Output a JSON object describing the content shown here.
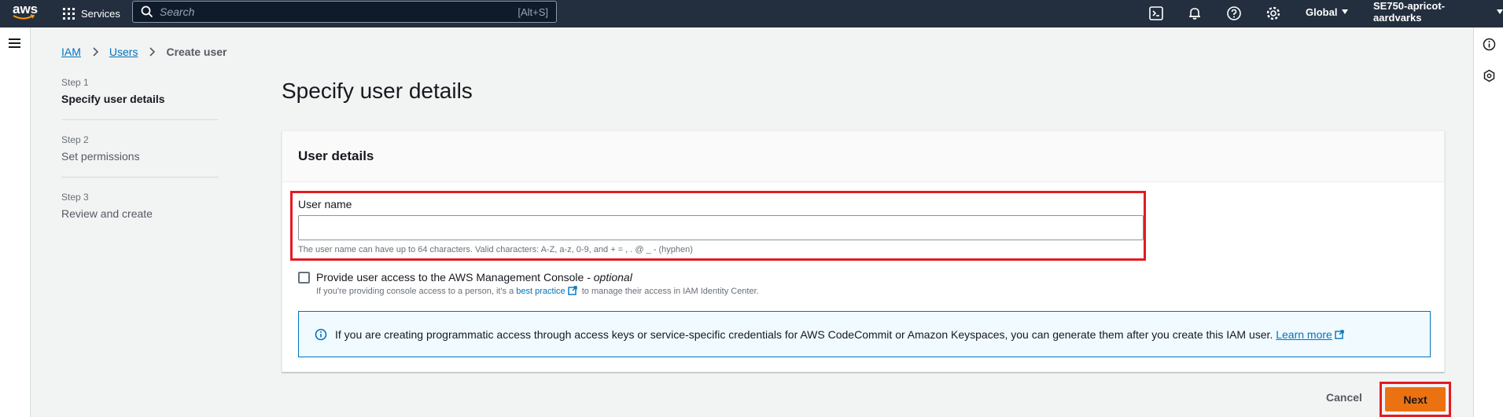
{
  "topnav": {
    "logo_text": "aws",
    "services_label": "Services",
    "search_placeholder": "Search",
    "search_shortcut": "[Alt+S]",
    "region": "Global",
    "account": "SE750-apricot-aardvarks",
    "icons": [
      "cloudshell-icon",
      "bell-icon",
      "help-icon",
      "settings-icon"
    ]
  },
  "breadcrumb": {
    "items": [
      "IAM",
      "Users",
      "Create user"
    ]
  },
  "steps": [
    {
      "num": "Step 1",
      "title": "Specify user details"
    },
    {
      "num": "Step 2",
      "title": "Set permissions"
    },
    {
      "num": "Step 3",
      "title": "Review and create"
    }
  ],
  "page": {
    "title": "Specify user details"
  },
  "panel": {
    "header": "User details",
    "username_label": "User name",
    "username_value": "",
    "username_hint": "The user name can have up to 64 characters. Valid characters: A-Z, a-z, 0-9, and + = , . @ _ - (hyphen)",
    "console_label": "Provide user access to the AWS Management Console - ",
    "console_optional": "optional",
    "console_checked": false,
    "console_sub_prefix": "If you're providing console access to a person, it's a ",
    "console_sub_link": "best practice",
    "console_sub_suffix": " to manage their access in IAM Identity Center.",
    "info_text": "If you are creating programmatic access through access keys or service-specific credentials for AWS CodeCommit or Amazon Keyspaces, you can generate them after you create this IAM user. ",
    "info_link": "Learn more"
  },
  "actions": {
    "cancel": "Cancel",
    "next": "Next"
  },
  "colors": {
    "nav_bg": "#232f3e",
    "primary_button": "#ec7211",
    "link": "#0073bb",
    "highlight": "#e31b23"
  }
}
